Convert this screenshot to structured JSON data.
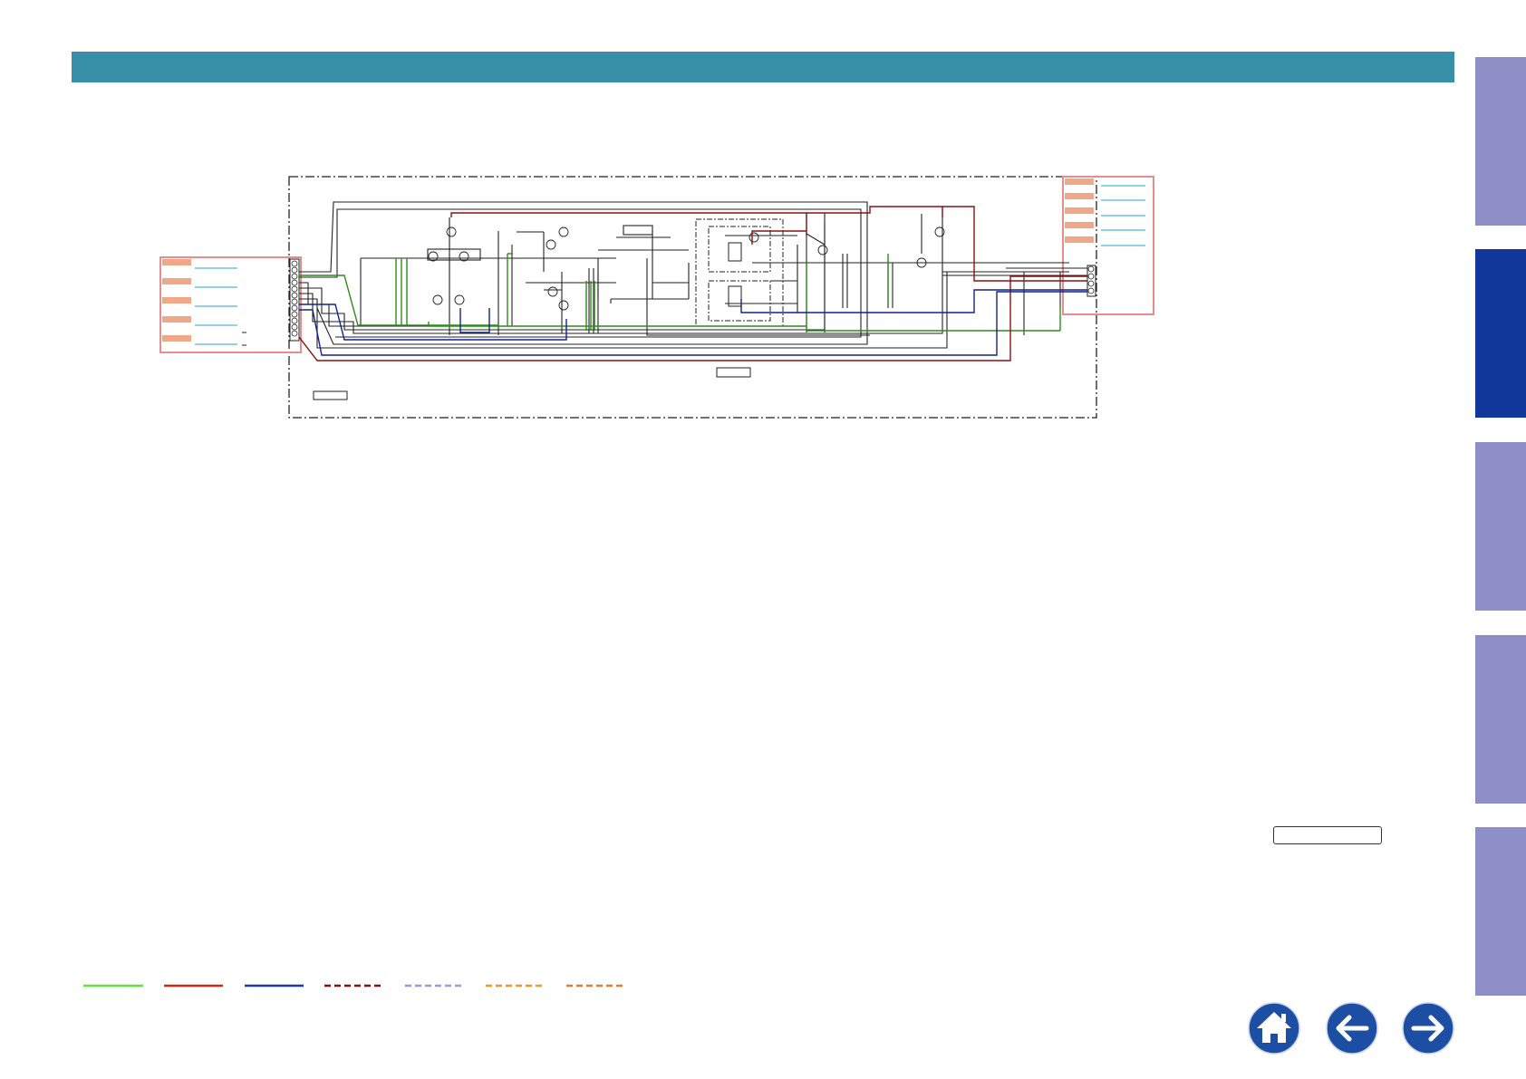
{
  "colors": {
    "header": "#3790a7",
    "tab_inactive": "#8e8fc7",
    "tab_active": "#12379a",
    "wire_green": "#2f8a1f",
    "wire_red": "#8a1010",
    "wire_blue": "#14228c",
    "connector_outline": "#e88c8c",
    "connector_pad": "#f0a888",
    "signal_line": "#4fb8d6"
  },
  "side_tabs": [
    {
      "id": "tab-1",
      "active": false
    },
    {
      "id": "tab-2",
      "active": true
    },
    {
      "id": "tab-3",
      "active": false
    },
    {
      "id": "tab-4",
      "active": false
    },
    {
      "id": "tab-5",
      "active": false
    }
  ],
  "legend": [
    {
      "style": "solid",
      "color": "#5ee43a"
    },
    {
      "style": "solid",
      "color": "#d9241c"
    },
    {
      "style": "solid",
      "color": "#1e36a8"
    },
    {
      "style": "dashed",
      "color": "#8a1010"
    },
    {
      "style": "dashed",
      "color": "#9a9adc"
    },
    {
      "style": "dashed",
      "color": "#e89a2a"
    },
    {
      "style": "dashed",
      "color": "#e0802a"
    }
  ],
  "nav": {
    "home_icon": "house-icon",
    "back_icon": "arrow-left-icon",
    "next_icon": "arrow-right-icon",
    "button_color": "#1c4fa3"
  }
}
